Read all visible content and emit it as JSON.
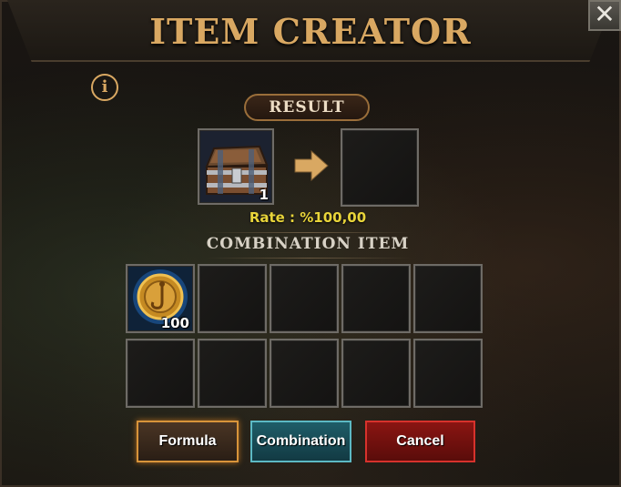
{
  "window": {
    "title": "ITEM CREATOR",
    "close_icon": "✕"
  },
  "info": {
    "icon": "i"
  },
  "result": {
    "label": "RESULT",
    "input_item": {
      "icon": "treasure-chest",
      "count": "1"
    },
    "output_item": null,
    "rate_text": "Rate : %100,00"
  },
  "combination": {
    "label": "COMBINATION ITEM",
    "slots": [
      {
        "icon": "gold-hook-coin",
        "count": "100"
      },
      null,
      null,
      null,
      null,
      null,
      null,
      null,
      null,
      null
    ]
  },
  "buttons": {
    "formula": "Formula",
    "combination": "Combination",
    "cancel": "Cancel"
  },
  "colors": {
    "title": "#d9a862",
    "rate": "#e8d43a",
    "formula_border": "#d8943a",
    "combination_border": "#5cb9c4",
    "cancel_border": "#d7322c"
  }
}
